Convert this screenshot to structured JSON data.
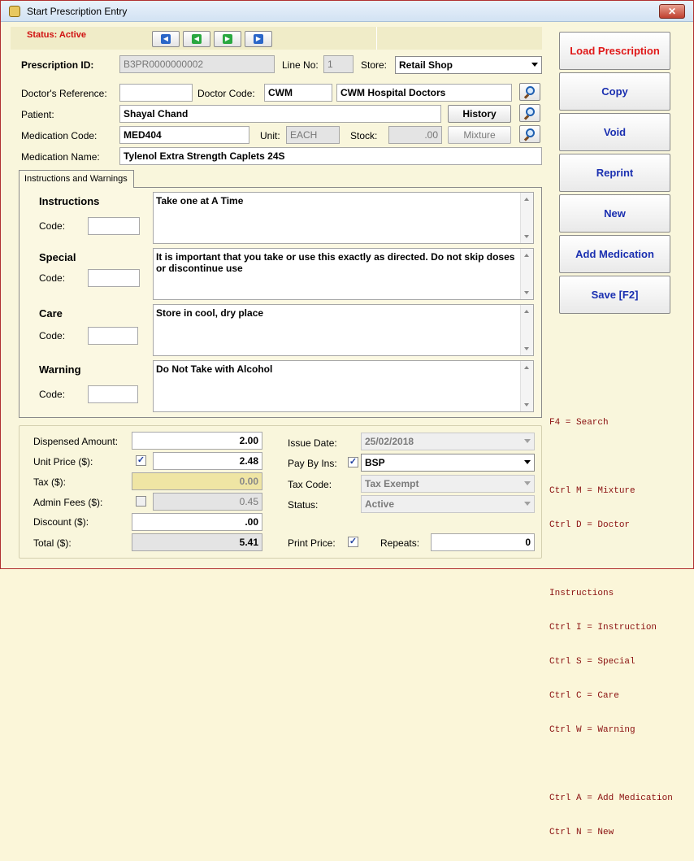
{
  "window": {
    "title": "Start Prescription Entry",
    "close_glyph": "✕"
  },
  "status": {
    "text": "Status: Active"
  },
  "nav": {
    "first": "first-record",
    "prev": "previous-record",
    "next": "next-record",
    "last": "last-record"
  },
  "header": {
    "prescription_id_label": "Prescription ID:",
    "prescription_id": "B3PR0000000002",
    "line_no_label": "Line No:",
    "line_no": "1",
    "store_label": "Store:",
    "store": "Retail Shop"
  },
  "doctor": {
    "reference_label": "Doctor's Reference:",
    "reference_value": "",
    "code_label": "Doctor Code:",
    "code": "CWM",
    "name": "CWM Hospital Doctors"
  },
  "patient": {
    "label": "Patient:",
    "value": "Shayal Chand",
    "history_button": "History"
  },
  "medication": {
    "code_label": "Medication Code:",
    "code": "MED404",
    "unit_label": "Unit:",
    "unit": "EACH",
    "stock_label": "Stock:",
    "stock": ".00",
    "mixture_button": "Mixture",
    "name_label": "Medication Name:",
    "name": "Tylenol Extra Strength Caplets 24S"
  },
  "tab": {
    "label": "Instructions and Warnings"
  },
  "sections": {
    "instructions": {
      "title": "Instructions",
      "code_label": "Code:",
      "text": "Take one at A Time"
    },
    "special": {
      "title": "Special",
      "code_label": "Code:",
      "text": "It is important that you take or use this exactly as directed. Do not skip doses or discontinue use"
    },
    "care": {
      "title": "Care",
      "code_label": "Code:",
      "text": "Store in cool, dry place"
    },
    "warning": {
      "title": "Warning",
      "code_label": "Code:",
      "text": "Do Not Take with Alcohol"
    }
  },
  "pricing": {
    "dispensed_label": "Dispensed Amount:",
    "dispensed": "2.00",
    "unit_price_label": "Unit Price ($):",
    "unit_price": "2.48",
    "tax_label": "Tax ($):",
    "tax": "0.00",
    "admin_fees_label": "Admin Fees ($):",
    "admin_fees": "0.45",
    "discount_label": "Discount ($):",
    "discount": ".00",
    "total_label": "Total ($):",
    "total": "5.41",
    "unit_price_checked": true,
    "admin_fees_checked": false
  },
  "details": {
    "issue_date_label": "Issue Date:",
    "issue_date": "25/02/2018",
    "pay_by_ins_label": "Pay By Ins:",
    "pay_by_ins": "BSP",
    "pay_by_ins_checked": true,
    "tax_code_label": "Tax Code:",
    "tax_code": "Tax Exempt",
    "status_label": "Status:",
    "status": "Active",
    "print_price_label": "Print Price:",
    "print_price_checked": true,
    "repeats_label": "Repeats:",
    "repeats": "0"
  },
  "side_buttons": {
    "load": "Load Prescription",
    "copy": "Copy",
    "void": "Void",
    "reprint": "Reprint",
    "new": "New",
    "add_medication": "Add Medication",
    "save": "Save [F2]"
  },
  "shortcuts": [
    "F4 = Search",
    "",
    "Ctrl M = Mixture",
    "Ctrl D = Doctor",
    "",
    "Instructions",
    "Ctrl I = Instruction",
    "Ctrl S = Special",
    "Ctrl C = Care",
    "Ctrl W = Warning",
    "",
    "Ctrl A = Add Medication",
    "Ctrl N = New"
  ],
  "colors": {
    "status_red": "#d01010",
    "button_blue": "#1a2fb0",
    "button_red": "#e01818",
    "panel_bg": "#f9f6dc"
  }
}
